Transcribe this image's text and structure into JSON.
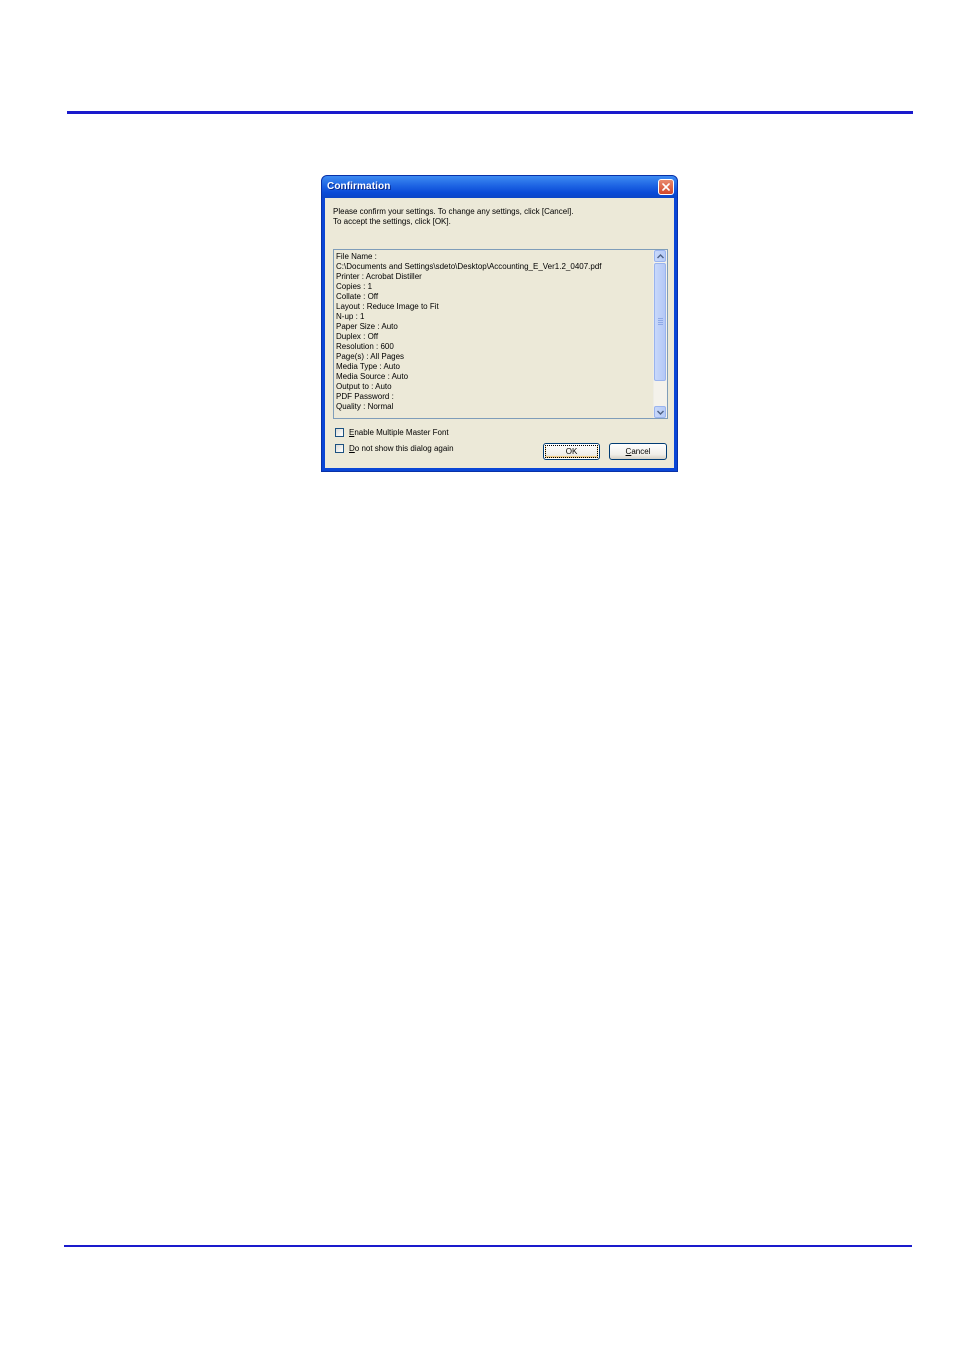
{
  "dialog": {
    "title": "Confirmation",
    "intro_line1": "Please confirm your settings. To change any settings, click [Cancel].",
    "intro_line2": "To accept the settings, click [OK].",
    "settings": [
      "File Name :",
      "C:\\Documents and Settings\\sdeto\\Desktop\\Accounting_E_Ver1.2_0407.pdf",
      "Printer : Acrobat Distiller",
      "Copies : 1",
      "Collate : Off",
      "Layout : Reduce Image to Fit",
      "N-up : 1",
      "Paper Size : Auto",
      "Duplex : Off",
      "Resolution : 600",
      "Page(s) : All Pages",
      "Media Type : Auto",
      "Media Source : Auto",
      "Output to : Auto",
      "PDF Password :",
      "Quality : Normal"
    ],
    "checkboxes": {
      "enable_mm_font": {
        "mnemonic": "E",
        "rest": "nable Multiple Master Font",
        "checked": false
      },
      "dont_show_again": {
        "mnemonic": "D",
        "rest": "o not show this dialog again",
        "checked": false
      }
    },
    "buttons": {
      "ok": "OK",
      "cancel_mnemonic": "C",
      "cancel_rest": "ancel"
    }
  },
  "colors": {
    "rule": "#1a1acc",
    "titlebar": "#0a46d6",
    "dialog_face": "#ece9d8"
  }
}
